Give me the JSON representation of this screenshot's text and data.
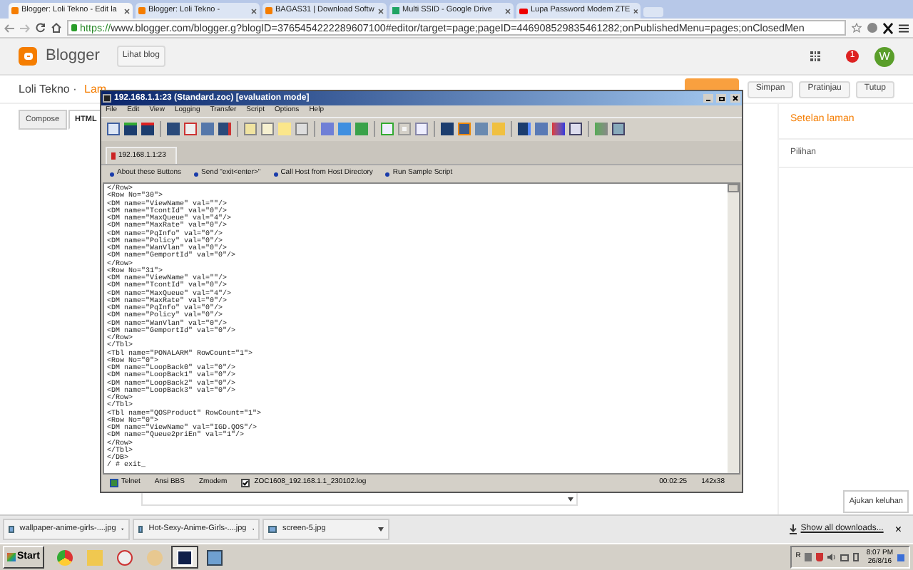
{
  "browser": {
    "tabs": [
      {
        "title": "Blogger: Loli Tekno - Edit la",
        "selected": true
      },
      {
        "title": "Blogger: Loli Tekno -",
        "selected": false
      },
      {
        "title": "BAGAS31 | Download Softw",
        "selected": false
      },
      {
        "title": "Multi SSID - Google Drive",
        "selected": false
      },
      {
        "title": "Lupa Password Modem ZTE",
        "selected": false
      }
    ],
    "url": {
      "scheme": "https://",
      "rest": "www.blogger.com/blogger.g?blogID=3765454222289607100#editor/target=page;pageID=446908529835461282;onPublishedMenu=pages;onClosedMen"
    }
  },
  "blogger": {
    "logo": "Blogger",
    "view_blog": "Lihat blog",
    "notifications": "1",
    "avatar": "W",
    "blog_title": "Loli Tekno · ",
    "page_title": "Lam",
    "buttons": [
      "Simpan",
      "Pratinjau",
      "Tutup"
    ],
    "editor_tabs": [
      {
        "label": "Compose",
        "selected": false
      },
      {
        "label": "HTML",
        "selected": true
      }
    ],
    "settings_title": "Setelan laman",
    "settings_items": [
      "Pilihan"
    ],
    "feedback": "Ajukan keluhan"
  },
  "terminal": {
    "title": "192.168.1.1:23 (Standard.zoc) [evaluation mode]",
    "menu": [
      "File",
      "Edit",
      "View",
      "Logging",
      "Transfer",
      "Script",
      "Options",
      "Help"
    ],
    "session_tab": "192.168.1.1:23",
    "user_buttons": [
      "About these Buttons",
      "Send \"exit<enter>\"",
      "Call Host from Host Directory",
      "Run Sample Script"
    ],
    "lines": [
      "</Row>",
      "<Row No=\"30\">",
      "<DM name=\"ViewName\" val=\"\"/>",
      "<DM name=\"TcontId\" val=\"0\"/>",
      "<DM name=\"MaxQueue\" val=\"4\"/>",
      "<DM name=\"MaxRate\" val=\"0\"/>",
      "<DM name=\"PqInfo\" val=\"0\"/>",
      "<DM name=\"Policy\" val=\"0\"/>",
      "<DM name=\"WanVlan\" val=\"0\"/>",
      "<DM name=\"GemportId\" val=\"0\"/>",
      "</Row>",
      "<Row No=\"31\">",
      "<DM name=\"ViewName\" val=\"\"/>",
      "<DM name=\"TcontId\" val=\"0\"/>",
      "<DM name=\"MaxQueue\" val=\"4\"/>",
      "<DM name=\"MaxRate\" val=\"0\"/>",
      "<DM name=\"PqInfo\" val=\"0\"/>",
      "<DM name=\"Policy\" val=\"0\"/>",
      "<DM name=\"WanVlan\" val=\"0\"/>",
      "<DM name=\"GemportId\" val=\"0\"/>",
      "</Row>",
      "</Tbl>",
      "<Tbl name=\"PONALARM\" RowCount=\"1\">",
      "<Row No=\"0\">",
      "<DM name=\"LoopBack0\" val=\"0\"/>",
      "<DM name=\"LoopBack1\" val=\"0\"/>",
      "<DM name=\"LoopBack2\" val=\"0\"/>",
      "<DM name=\"LoopBack3\" val=\"0\"/>",
      "</Row>",
      "</Tbl>",
      "<Tbl name=\"QOSProduct\" RowCount=\"1\">",
      "<Row No=\"0\">",
      "<DM name=\"ViewName\" val=\"IGD.QOS\"/>",
      "<DM name=\"Queue2priEn\" val=\"1\"/>",
      "</Row>",
      "</Tbl>",
      "</DB>",
      "/ # exit_"
    ],
    "status": {
      "protocol": "Telnet",
      "emulation": "Ansi BBS",
      "transfer": "Zmodem",
      "logging": true,
      "logfile": "ZOC1608_192.168.1.1_230102.log",
      "time": "00:02:25",
      "size": "142x38"
    }
  },
  "downloads": {
    "items": [
      "wallpaper-anime-girls-....jpg",
      "Hot-Sexy-Anime-Girls-....jpg",
      "screen-5.jpg"
    ],
    "show_all": "Show all downloads...",
    "close": "×"
  },
  "taskbar": {
    "start": "Start",
    "tray_letter": "R",
    "time": "8:07 PM",
    "date": "26/8/16"
  }
}
